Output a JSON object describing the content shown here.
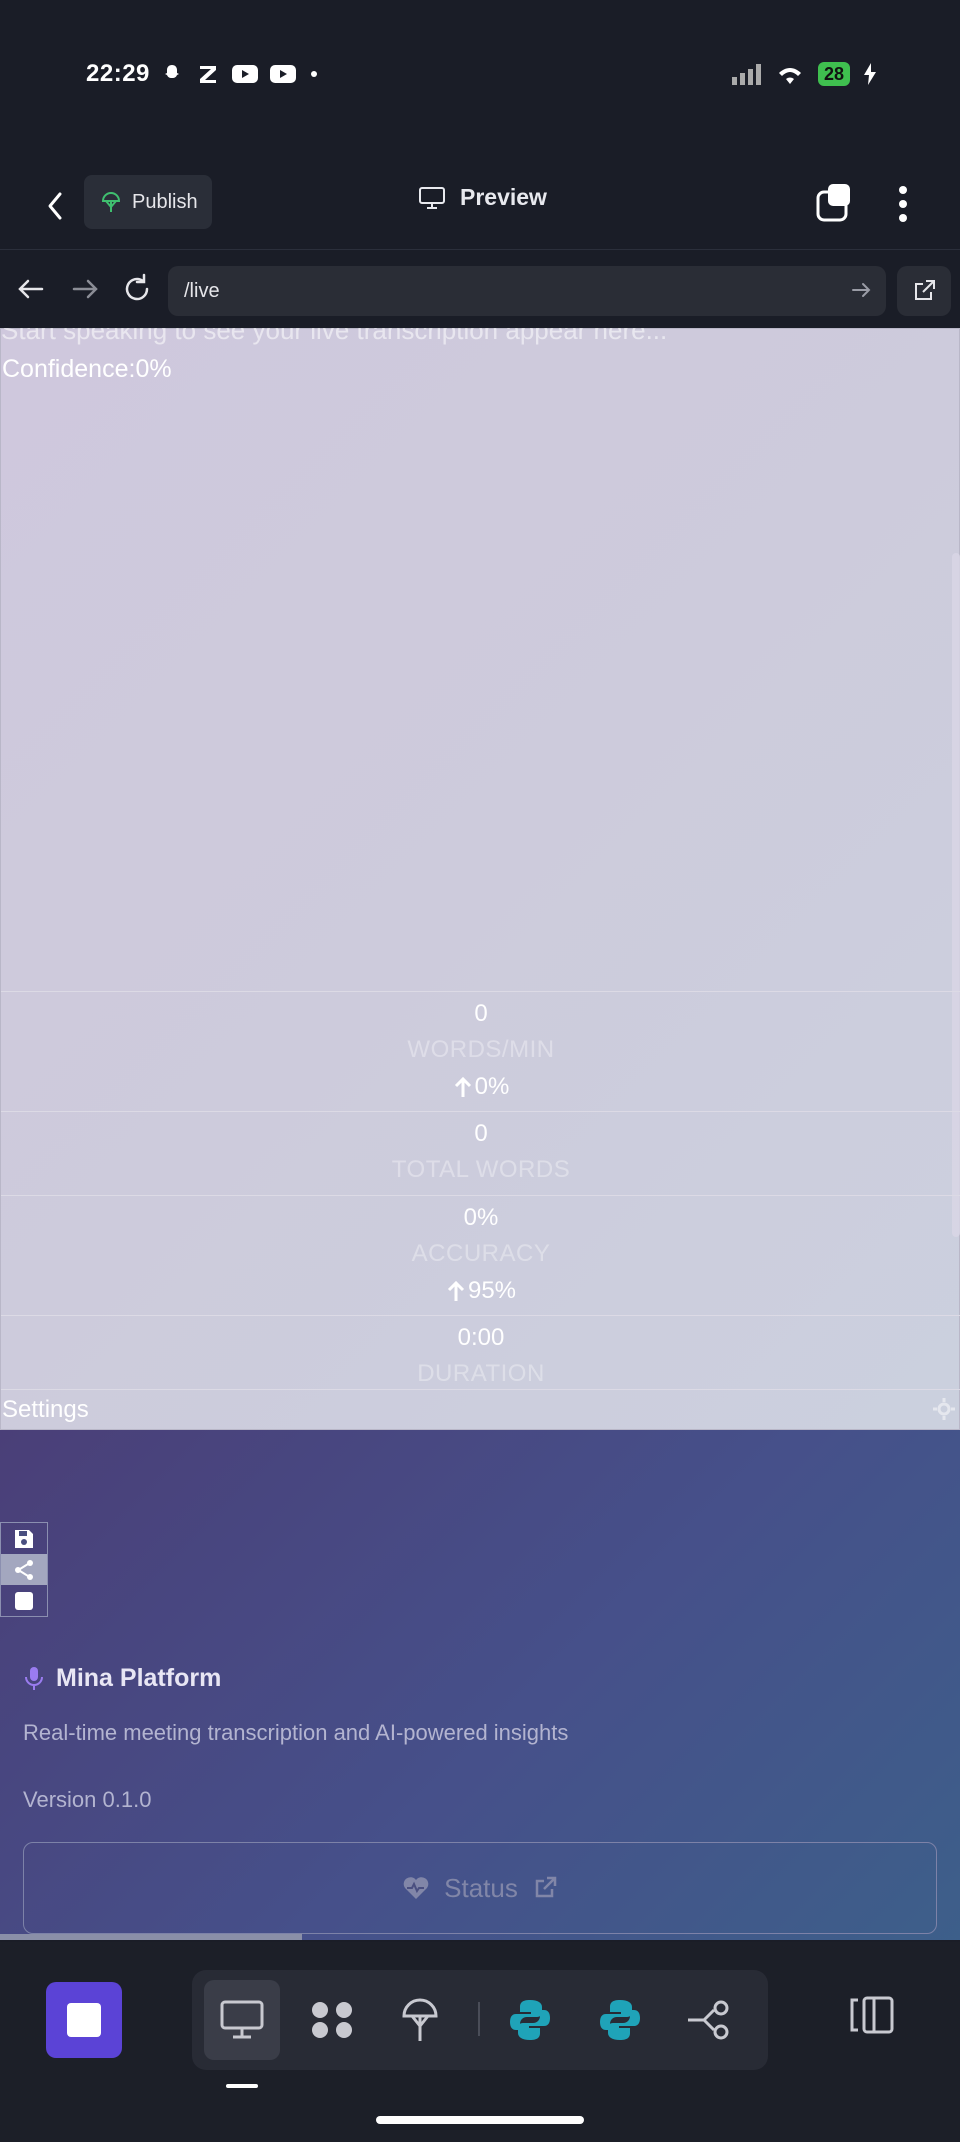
{
  "status_bar": {
    "time": "22:29",
    "notification_icons": [
      "snapchat-icon",
      "z-app-icon",
      "youtube-icon",
      "youtube-icon",
      "dot-icon"
    ],
    "battery": "28"
  },
  "toolbar": {
    "publish_label": "Publish",
    "preview_label": "Preview"
  },
  "url_bar": {
    "path": "/live"
  },
  "live_page": {
    "hint": "Start speaking to see your live transcription appear here...",
    "confidence_label": "Confidence:",
    "confidence_value": "0%",
    "stats": [
      {
        "value": "0",
        "label": "WORDS/MIN",
        "trend": "0%"
      },
      {
        "value": "0",
        "label": "TOTAL WORDS"
      },
      {
        "value": "0%",
        "label": "ACCURACY",
        "trend": "95%"
      },
      {
        "value": "0:00",
        "label": "DURATION"
      }
    ],
    "settings_label": "Settings"
  },
  "footer": {
    "brand": "Mina Platform",
    "tagline": "Real-time meeting transcription and AI-powered insights",
    "version": "Version 0.1.0",
    "status_label": "Status"
  },
  "colors": {
    "accent": "#5b43d6",
    "publish_icon": "#3fbf6f",
    "python_icon": "#1fa3b8",
    "mic_icon": "#9a7cf0"
  }
}
